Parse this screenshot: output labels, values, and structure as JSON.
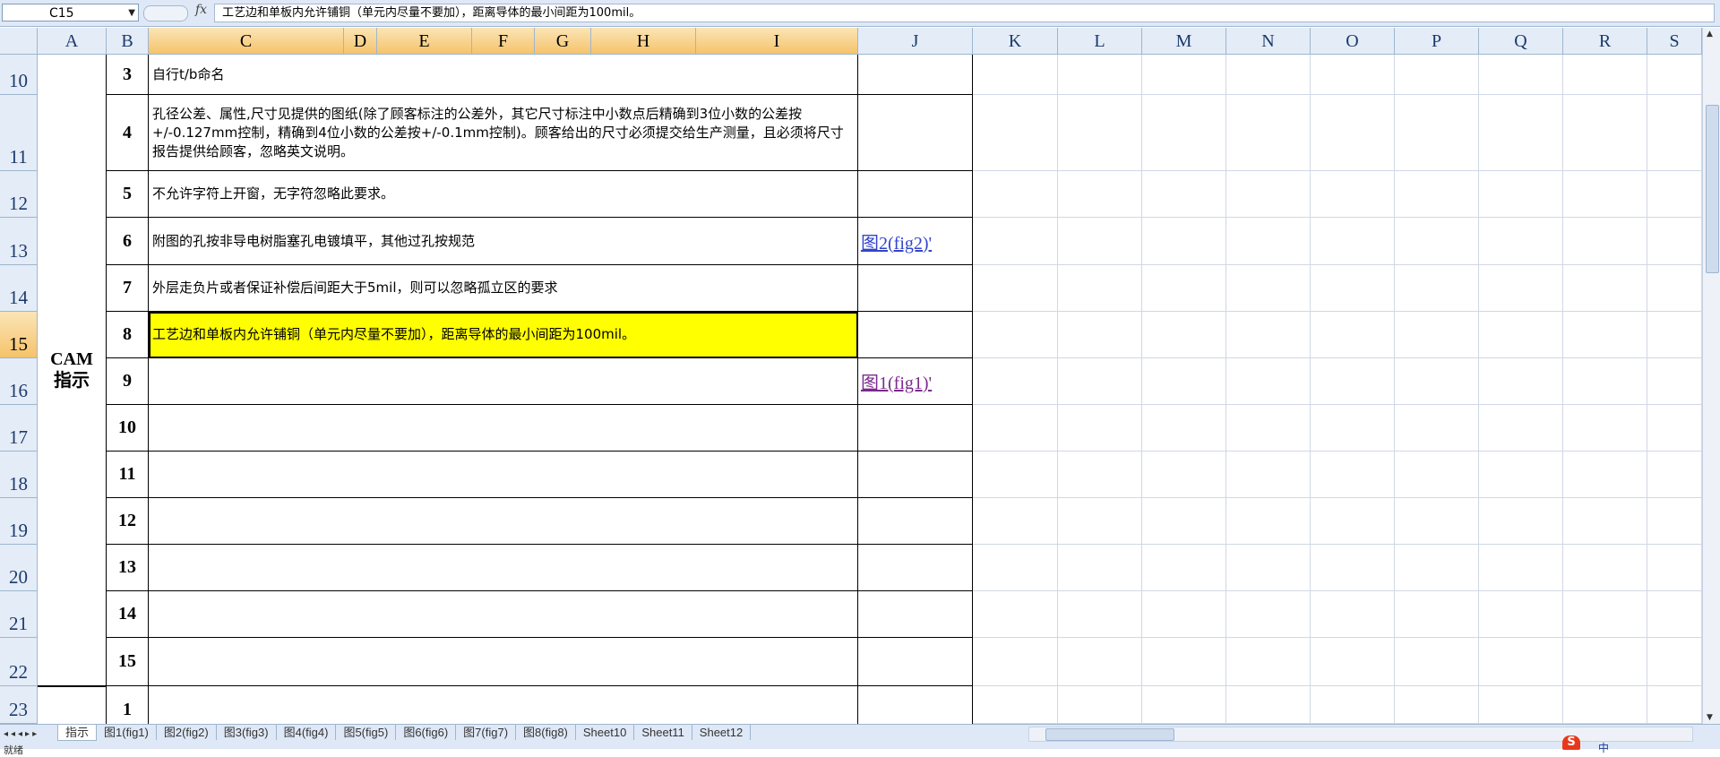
{
  "formula_bar": {
    "name_box": "C15",
    "fx_label": "fx",
    "content": "工艺边和单板内允许铺铜（单元内尽量不要加），距离导体的最小间距为100mil。"
  },
  "columns": [
    "A",
    "B",
    "C",
    "D",
    "E",
    "F",
    "G",
    "H",
    "I",
    "J",
    "K",
    "L",
    "M",
    "N",
    "O",
    "P",
    "Q",
    "R",
    "S"
  ],
  "rows": [
    "10",
    "11",
    "12",
    "13",
    "14",
    "15",
    "16",
    "17",
    "18",
    "19",
    "20",
    "21",
    "22",
    "23"
  ],
  "selected_column": "C",
  "selected_row": "15",
  "section_label": "CAM\n指示",
  "table": [
    {
      "num": "3",
      "text": "自行t/b命名",
      "ref": ""
    },
    {
      "num": "4",
      "text": "孔径公差、属性,尺寸见提供的图纸(除了顾客标注的公差外，其它尺寸标注中小数点后精确到3位小数的公差按+/-0.127mm控制，精确到4位小数的公差按+/-0.1mm控制)。顾客给出的尺寸必须提交给生产测量，且必须将尺寸报告提供给顾客，忽略英文说明。",
      "ref": ""
    },
    {
      "num": "5",
      "text": "不允许字符上开窗，无字符忽略此要求。",
      "ref": ""
    },
    {
      "num": "6",
      "text": "附图的孔按非导电树脂塞孔电镀填平，其他过孔按规范",
      "ref": "图2(fig2)'"
    },
    {
      "num": "7",
      "text": "外层走负片或者保证补偿后间距大于5mil，则可以忽略孤立区的要求",
      "ref": ""
    },
    {
      "num": "8",
      "text": "工艺边和单板内允许铺铜（单元内尽量不要加），距离导体的最小间距为100mil。",
      "ref": ""
    },
    {
      "num": "9",
      "text": "",
      "ref": "图1(fig1)'"
    },
    {
      "num": "10",
      "text": "",
      "ref": ""
    },
    {
      "num": "11",
      "text": "",
      "ref": ""
    },
    {
      "num": "12",
      "text": "",
      "ref": ""
    },
    {
      "num": "13",
      "text": "",
      "ref": ""
    },
    {
      "num": "14",
      "text": "",
      "ref": ""
    },
    {
      "num": "15",
      "text": "",
      "ref": ""
    },
    {
      "num": "1",
      "text": "",
      "ref": ""
    }
  ],
  "highlight_color": "#ffff00",
  "sheet_tabs": [
    "指示",
    "图1(fig1)",
    "图2(fig2)",
    "图3(fig3)",
    "图4(fig4)",
    "图5(fig5)",
    "图6(fig6)",
    "图7(fig7)",
    "图8(fig8)",
    "Sheet10",
    "Sheet11",
    "Sheet12"
  ],
  "active_tab": "指示",
  "status_text": "就绪",
  "ime_indicator": "中",
  "ime_logo": "S"
}
